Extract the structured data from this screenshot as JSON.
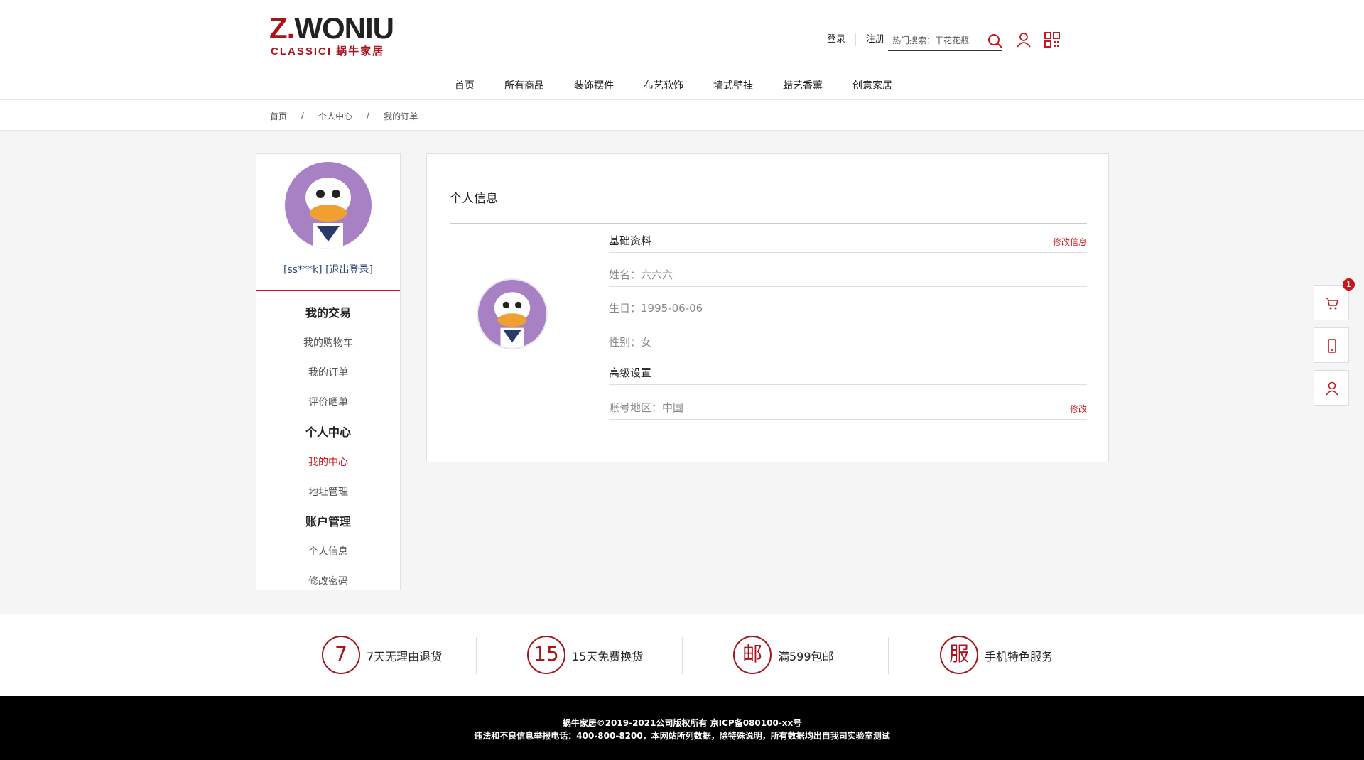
{
  "brand": {
    "logo_main_prefix": "Z.",
    "logo_main_rest": "WONIU",
    "logo_sub": "CLASSICI 蜗牛家居"
  },
  "header": {
    "login": "登录",
    "register": "注册",
    "search_placeholder": "热门搜索：干花花瓶"
  },
  "nav": [
    "首页",
    "所有商品",
    "装饰摆件",
    "布艺软饰",
    "墙式壁挂",
    "蜡艺香薰",
    "创意家居"
  ],
  "breadcrumb": [
    "首页",
    "/",
    "个人中心",
    "/",
    "我的订单"
  ],
  "sidebar": {
    "user": "[ss***k]  [退出登录]",
    "menu": [
      {
        "label": "我的交易",
        "type": "h"
      },
      {
        "label": "我的购物车",
        "type": ""
      },
      {
        "label": "我的订单",
        "type": ""
      },
      {
        "label": "评价晒单",
        "type": ""
      },
      {
        "label": "个人中心",
        "type": "h"
      },
      {
        "label": "我的中心",
        "type": "act"
      },
      {
        "label": "地址管理",
        "type": ""
      },
      {
        "label": "账户管理",
        "type": "h"
      },
      {
        "label": "个人信息",
        "type": ""
      },
      {
        "label": "修改密码",
        "type": ""
      }
    ]
  },
  "content": {
    "title": "个人信息",
    "basic_title": "基础资料",
    "edit_info": "修改信息",
    "name": "姓名：六六六",
    "birthday": "生日：1995-06-06",
    "gender": "性别：女",
    "advanced_title": "高级设置",
    "region": "账号地区：中国",
    "edit": "修改"
  },
  "cart_badge": "1",
  "services": [
    {
      "icon": "7",
      "text": "7天无理由退货"
    },
    {
      "icon": "15",
      "text": "15天免费换货"
    },
    {
      "icon": "邮",
      "text": "满599包邮"
    },
    {
      "icon": "服",
      "text": "手机特色服务"
    }
  ],
  "footer": {
    "line1": "蜗牛家居©2019-2021公司版权所有 京ICP备080100-xx号",
    "line2": "违法和不良信息举报电话：400-800-8200，本网站所列数据，除特殊说明，所有数据均出自我司实验室测试"
  },
  "colors": {
    "accent": "#c8161d",
    "brand": "#a8141c"
  }
}
